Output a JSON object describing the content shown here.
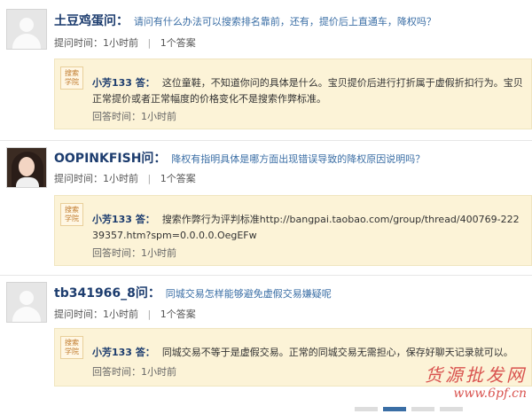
{
  "questions": [
    {
      "asker": "土豆鸡蛋",
      "q_suffix": "问：",
      "question": "请问有什么办法可以搜索排名靠前，还有，提价后上直通车，降权吗？",
      "ask_time_label": "提问时间：",
      "ask_time": "1小时前",
      "answer_count": "1个答案",
      "answer": {
        "answerer": "小芳133",
        "a_prefix": "答：",
        "text": "这位童鞋，不知道你问的具体是什么。宝贝提价后进行打折属于虚假折扣行为。宝贝正常提价或者正常幅度的价格变化不是搜索作弊标准。",
        "time_label": "回答时间：",
        "time": "1小时前"
      }
    },
    {
      "asker": "OOPINKFISH",
      "q_suffix": "问：",
      "question": "降权有指明具体是哪方面出现错误导致的降权原因说明吗？",
      "ask_time_label": "提问时间：",
      "ask_time": "1小时前",
      "answer_count": "1个答案",
      "answer": {
        "answerer": "小芳133",
        "a_prefix": "答：",
        "text": "搜索作弊行为评判标准http://bangpai.taobao.com/group/thread/400769-22239357.htm?spm=0.0.0.0.OegEFw",
        "time_label": "回答时间：",
        "time": "1小时前"
      }
    },
    {
      "asker": "tb341966_8",
      "q_suffix": "问：",
      "question": "同城交易怎样能够避免虚假交易嫌疑呢",
      "ask_time_label": "提问时间：",
      "ask_time": "1小时前",
      "answer_count": "1个答案",
      "answer": {
        "answerer": "小芳133",
        "a_prefix": "答：",
        "text": "同城交易不等于是虚假交易。正常的同城交易无需担心，保存好聊天记录就可以。",
        "time_label": "回答时间：",
        "time": "1小时前"
      }
    }
  ],
  "logo_text": "搜索学院",
  "watermark": {
    "line1": "货源批发网",
    "line2": "www.6pf.cn"
  },
  "colors": {
    "answer_bg": "#fcf3d7",
    "link": "#3a6ea5",
    "name": "#1c3c6e"
  },
  "icons": [
    "default-avatar-icon",
    "user-photo-avatar",
    "search-academy-logo"
  ]
}
